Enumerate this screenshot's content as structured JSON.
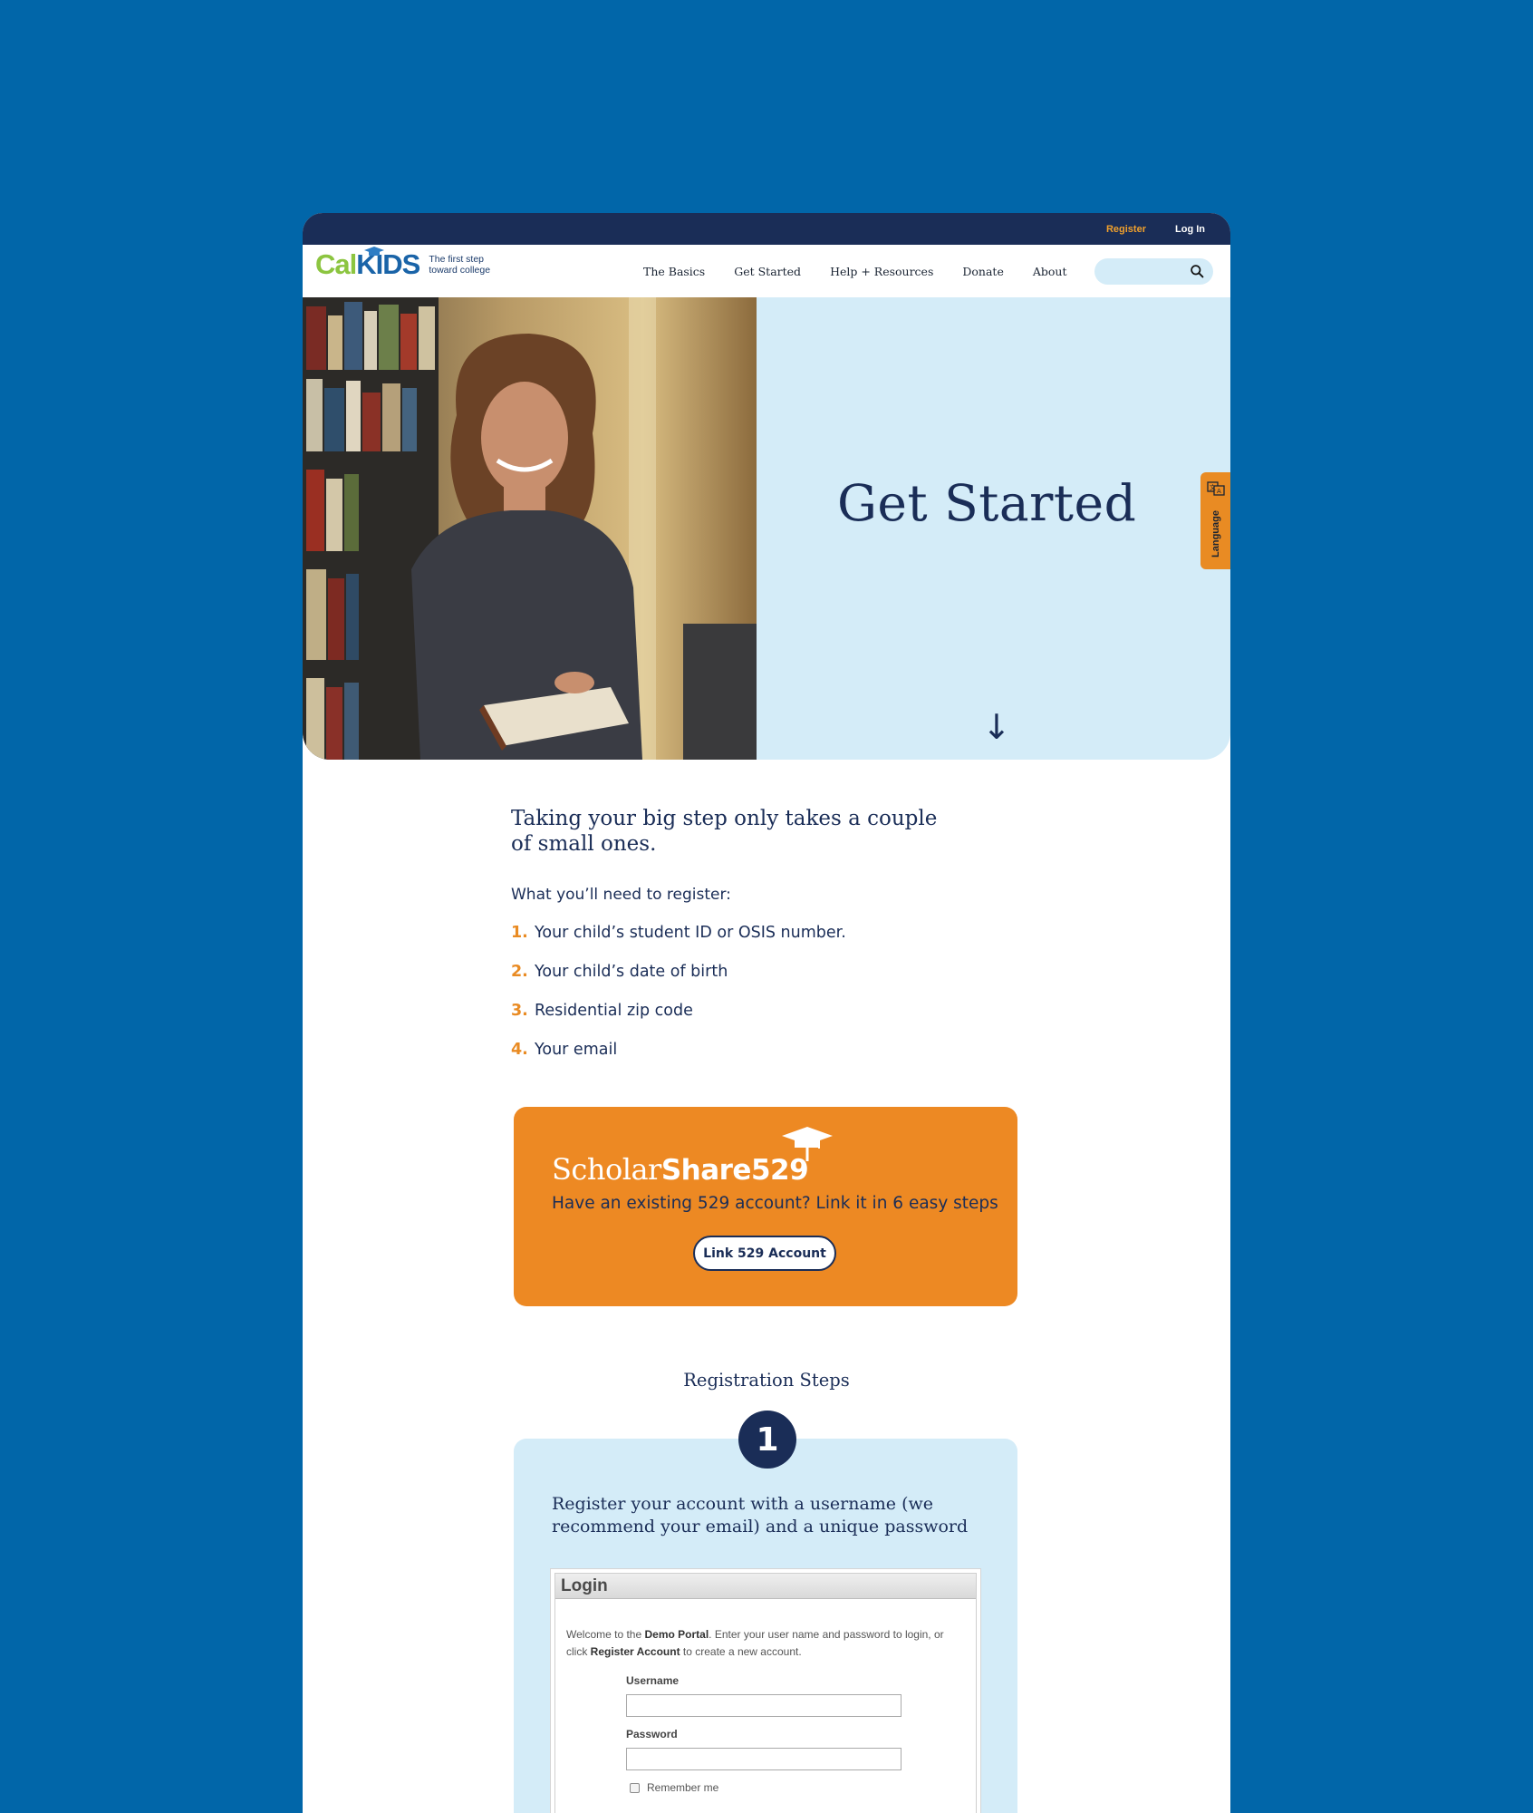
{
  "topbar": {
    "register": "Register",
    "login": "Log In"
  },
  "logo": {
    "cal": "Cal",
    "kids": "KIDS",
    "tagline_line1": "The first step",
    "tagline_line2": "toward college"
  },
  "nav": {
    "items": [
      "The Basics",
      "Get Started",
      "Help + Resources",
      "Donate",
      "About"
    ]
  },
  "search": {
    "placeholder": ""
  },
  "hero": {
    "title": "Get Started"
  },
  "language_tab": {
    "label": "Language"
  },
  "intro": {
    "heading": "Taking your big step only takes a couple of small ones.",
    "need_label": "What you’ll need to register:",
    "requirements": [
      {
        "num": "1.",
        "text": "Your child’s student ID or OSIS number."
      },
      {
        "num": "2.",
        "text": "Your child’s date of birth"
      },
      {
        "num": "3.",
        "text": "Residential zip code"
      },
      {
        "num": "4.",
        "text": "Your email"
      }
    ]
  },
  "scholarshare": {
    "logo_light": "Scholar",
    "logo_bold": "Share529",
    "text": "Have an existing 529 account? Link it in 6 easy steps",
    "button": "Link 529 Account"
  },
  "registration": {
    "title": "Registration Steps",
    "step_number": "1",
    "step_text": "Register your account with a username (we recommend your email) and a unique password",
    "login_panel": {
      "title": "Login",
      "welcome_1": "Welcome to the ",
      "welcome_portal": "Demo Portal",
      "welcome_2": ".  Enter your user name and password to login, or click ",
      "welcome_register": "Register Account",
      "welcome_3": " to create a new account.",
      "username_label": "Username",
      "password_label": "Password",
      "remember_label": "Remember me"
    }
  },
  "colors": {
    "background": "#0166a9",
    "navy": "#1a2d57",
    "light_blue": "#d4ecf8",
    "orange": "#ed8923"
  }
}
